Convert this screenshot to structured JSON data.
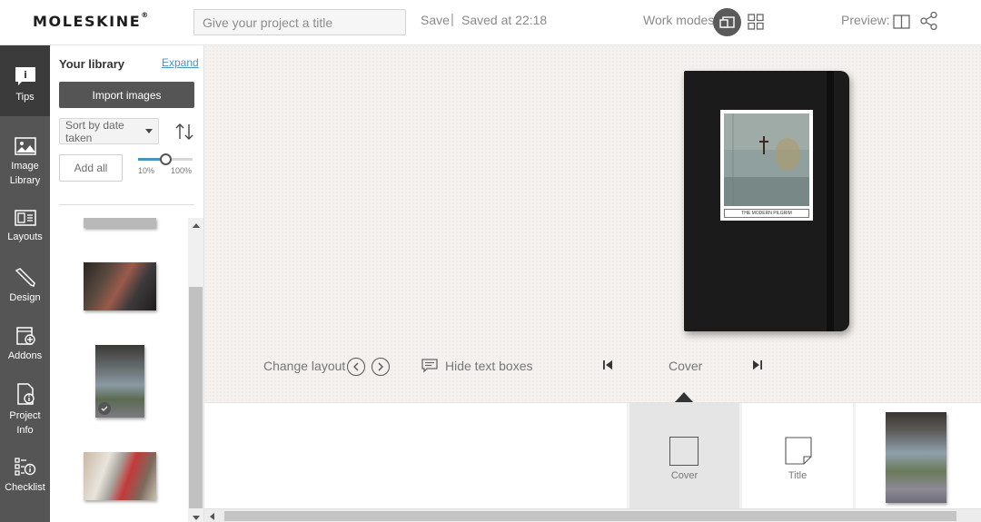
{
  "header": {
    "logo": "MOLESKINE",
    "logo_mark": "®",
    "title_placeholder": "Give your project a title",
    "save_label": "Save",
    "separator": "|",
    "saved_status": "Saved at 22:18",
    "work_modes_label": "Work modes:",
    "preview_label": "Preview:"
  },
  "nav": {
    "items": [
      {
        "label": "Tips",
        "icon": "info-icon",
        "active": true
      },
      {
        "label": "Image Library",
        "icon": "image-icon"
      },
      {
        "label": "Layouts",
        "icon": "layout-icon"
      },
      {
        "label": "Design",
        "icon": "pencil-icon"
      },
      {
        "label": "Addons",
        "icon": "addon-icon"
      },
      {
        "label": "Project Info",
        "icon": "document-info-icon"
      },
      {
        "label": "Checklist",
        "icon": "checklist-icon"
      }
    ]
  },
  "library": {
    "title": "Your library",
    "expand_label": "Expand",
    "import_label": "Import images",
    "sort_value": "Sort by date taken",
    "add_all_label": "Add all",
    "zoom_min_label": "10%",
    "zoom_max_label": "100%",
    "zoom_value": 0.5
  },
  "cover": {
    "caption": "THE MODERN PILGRIM"
  },
  "controls": {
    "change_layout_label": "Change layout",
    "hide_text_label": "Hide text boxes",
    "current_page": "Cover"
  },
  "pages": [
    {
      "label": "Cover",
      "active": true
    },
    {
      "label": "Title"
    }
  ],
  "colors": {
    "nav_bg": "#555555",
    "nav_active": "#3b3b3b",
    "accent_link": "#4a93c1",
    "notebook": "#1b1b1b"
  }
}
